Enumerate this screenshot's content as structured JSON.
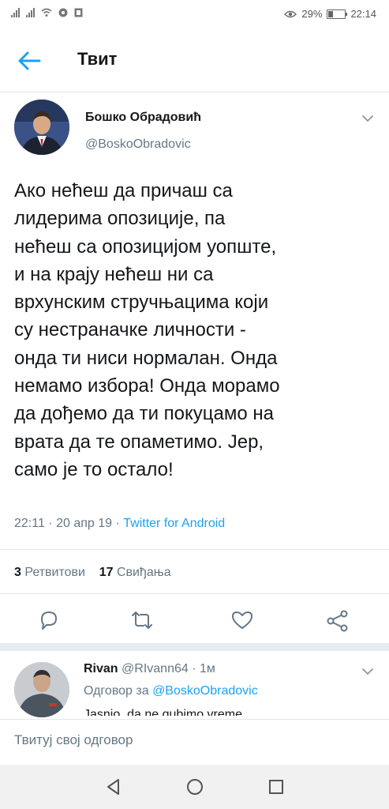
{
  "status": {
    "battery": "29%",
    "battery_level": 0.29,
    "time": "22:14"
  },
  "appbar": {
    "title": "Твит"
  },
  "tweet": {
    "author_name": "Бошко Обрадовић",
    "author_handle": "@BoskoObradovic",
    "text_lines": [
      "Ако нећеш да причаш са",
      "лидерима опозиције, па",
      "нећеш са опозицијом уопште,",
      "и на крају нећеш ни са",
      "врхунским стручњацима који",
      "су нестраначке личности -",
      "онда ти ниси нормалан. Онда",
      "немамо избора! Онда морамо",
      "да дођемо да ти покуцамо на",
      "врата да те опаметимо. Јер,",
      "само је то остало!"
    ],
    "time": "22:11",
    "date": "20 апр 19",
    "source": "Twitter for Android",
    "retweets_count": "3",
    "retweets_label": "Ретвитови",
    "likes_count": "17",
    "likes_label": "Свиђања"
  },
  "actions": {
    "icons": [
      "reply-icon",
      "retweet-icon",
      "like-icon",
      "share-icon"
    ]
  },
  "reply": {
    "name": "Rivan",
    "handle": "@RIvann64",
    "age": "1м",
    "replying_to_label": "Одговор за",
    "replying_to_handle": "@BoskoObradovic",
    "text": "Jasnio, da ne gubimo vreme"
  },
  "compose": {
    "placeholder": "Твитуј свој одговор"
  },
  "colors": {
    "accent": "#1da1f2",
    "secondary_text": "#657786",
    "divider": "#e1e8ed"
  }
}
